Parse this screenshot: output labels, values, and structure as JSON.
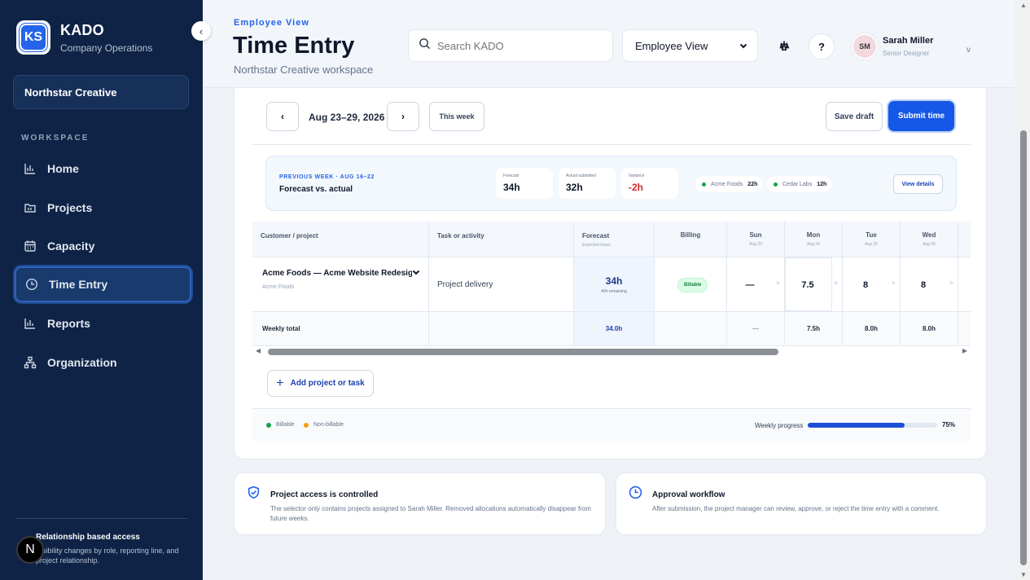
{
  "sidebar": {
    "logo": "KS",
    "app_name": "KADO",
    "app_sub": "Company Operations",
    "collapse_icon": "‹",
    "org_name": "Northstar Creative",
    "section_label": "WORKSPACE",
    "items": [
      {
        "label": "Home",
        "icon": "bar-chart-icon"
      },
      {
        "label": "Projects",
        "icon": "folder-icon"
      },
      {
        "label": "Capacity",
        "icon": "calendar-icon"
      },
      {
        "label": "Time Entry",
        "icon": "clock-icon",
        "active": true
      },
      {
        "label": "Reports",
        "icon": "bar-chart-icon"
      },
      {
        "label": "Organization",
        "icon": "hierarchy-icon"
      }
    ],
    "footer_title": "Relationship based access",
    "footer_desc": "Visibility changes by role, reporting line, and project relationship.",
    "badge": "N"
  },
  "header": {
    "eyebrow": "Employee View",
    "title": "Time Entry",
    "subtitle": "Northstar Creative workspace",
    "search_placeholder": "Search KADO",
    "view_select": "Employee View",
    "help_label": "?",
    "user_initials": "SM",
    "user_name": "Sarah Miller",
    "user_role": "Senior Designer",
    "user_caret": "v"
  },
  "week": {
    "prev": "‹",
    "next": "›",
    "range": "Aug 23–29, 2026",
    "this_week": "This week",
    "save_draft": "Save draft",
    "submit": "Submit time"
  },
  "previous_week": {
    "eyebrow": "PREVIOUS WEEK · AUG 16–22",
    "title": "Forecast vs. actual",
    "stats": [
      {
        "label": "Forecast",
        "value": "34h"
      },
      {
        "label": "Actual submitted",
        "value": "32h"
      },
      {
        "label": "Variance",
        "value": "-2h"
      }
    ],
    "chips": [
      {
        "name": "Acme Foods",
        "value": "22h"
      },
      {
        "name": "Cedar Labs",
        "value": "12h"
      }
    ],
    "view_details": "View details"
  },
  "table": {
    "headers": {
      "project": "Customer / project",
      "task": "Task or activity",
      "forecast": "Forecast",
      "forecast_sub": "Expected hours",
      "billing": "Billing",
      "days": [
        {
          "name": "Sun",
          "date": "Aug 23"
        },
        {
          "name": "Mon",
          "date": "Aug 24"
        },
        {
          "name": "Tue",
          "date": "Aug 25"
        },
        {
          "name": "Wed",
          "date": "Aug 26"
        }
      ]
    },
    "row": {
      "project": "Acme Foods — Acme Website Redesign",
      "customer": "Acme Foods",
      "task": "Project delivery",
      "forecast": "34h",
      "forecast_sub": "40h remaining",
      "billing": "Billable",
      "unit": "h",
      "days": [
        "—",
        "7.5",
        "8",
        "8"
      ]
    },
    "total": {
      "label": "Weekly total",
      "forecast": "34.0h",
      "days": [
        "—",
        "7.5h",
        "8.0h",
        "8.0h"
      ]
    }
  },
  "add_button": "Add project or task",
  "legend": [
    {
      "label": "Billable",
      "color": "#16a34a"
    },
    {
      "label": "Non-billable",
      "color": "#f59e0b"
    }
  ],
  "progress": {
    "label": "Weekly progress",
    "value": 75,
    "text": "75%"
  },
  "info": [
    {
      "title": "Project access is controlled",
      "desc": "The selector only contains projects assigned to Sarah Miller. Removed allocations automatically disappear from future weeks.",
      "icon": "shield-check-icon"
    },
    {
      "title": "Approval workflow",
      "desc": "After submission, the project manager can review, approve, or reject the time entry with a comment.",
      "icon": "clock-icon"
    }
  ]
}
